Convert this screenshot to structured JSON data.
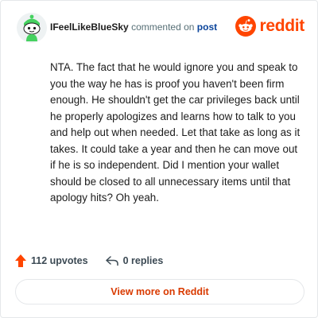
{
  "comment": {
    "username": "IFeelLikeBlueSky",
    "action_text": "commented on",
    "post_link": "post",
    "body": "NTA. The fact that he would ignore you and speak to you the way he has is proof you haven't been firm enough. He shouldn't get the car privileges back until he properly apologizes and learns how to talk to you and help out when needed. Let that take as long as it takes. It could take a year and then he can move out if he is so independent. Did I mention your wallet should be closed to all unnecessary items until that apology hits? Oh yeah."
  },
  "brand": {
    "name": "reddit",
    "logo_icon": "reddit-snoo-icon",
    "color": "#ff4500"
  },
  "actions": {
    "upvotes_label": "112 upvotes",
    "upvote_icon": "upvote-arrow-icon",
    "upvote_color": "#ff4500",
    "replies_label": "0 replies",
    "reply_icon": "reply-arrow-icon"
  },
  "footer": {
    "view_more_label": "View more on Reddit",
    "view_more_color": "#d93a00"
  },
  "avatar": {
    "icon": "snoo-avatar-icon",
    "accent": "#46d160"
  }
}
